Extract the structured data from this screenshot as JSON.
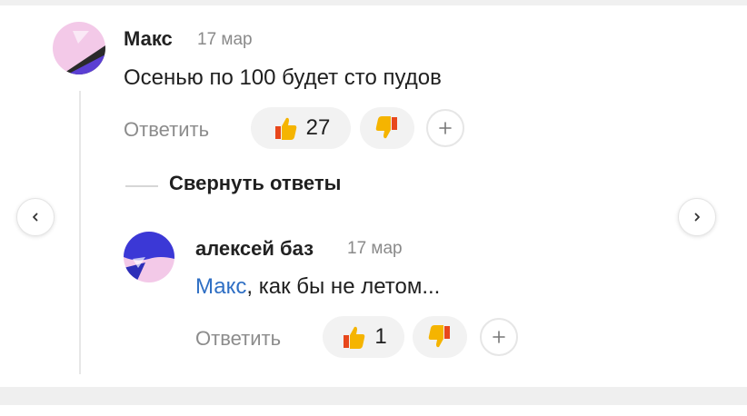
{
  "comments": [
    {
      "author": "Макс",
      "date": "17 мар",
      "text": "Осенью по 100 будет сто пудов",
      "reply_label": "Ответить",
      "likes": "27",
      "like_icon": "thumbs-up-icon",
      "dislike_icon": "thumbs-down-icon",
      "add_reaction_icon": "plus-icon"
    },
    {
      "author": "алексей баз",
      "date": "17 мар",
      "mention": "Макс",
      "text": ", как бы не летом...",
      "reply_label": "Ответить",
      "likes": "1",
      "like_icon": "thumbs-up-icon",
      "dislike_icon": "thumbs-down-icon",
      "add_reaction_icon": "plus-icon"
    }
  ],
  "thread": {
    "collapse_label": "Свернуть ответы"
  },
  "nav": {
    "prev_icon": "chevron-left-icon",
    "next_icon": "chevron-right-icon"
  },
  "colors": {
    "mention": "#2f6fc4",
    "thumb": "#f5b400",
    "thumb_accent": "#e8471c",
    "avatar_dark": "#3b38d6"
  }
}
